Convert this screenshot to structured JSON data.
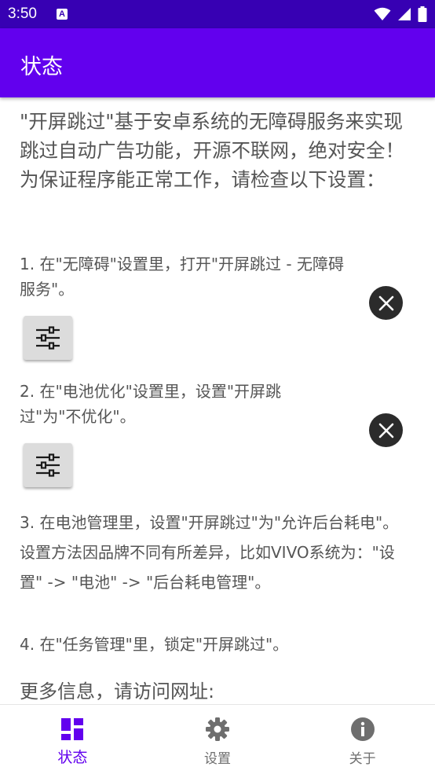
{
  "status_bar": {
    "time": "3:50",
    "notification_letter": "A"
  },
  "app_bar": {
    "title": "状态"
  },
  "intro": "\"开屏跳过\"基于安卓系统的无障碍服务来实现跳过自动广告功能，开源不联网，绝对安全！为保证程序能正常工作，请检查以下设置：",
  "steps": [
    {
      "text": "1. 在\"无障碍\"设置里，打开\"开屏跳过 - 无障碍服务\"。"
    },
    {
      "text": "2. 在\"电池优化\"设置里，设置\"开屏跳过\"为\"不优化\"。"
    },
    {
      "text": "3. 在电池管理里，设置\"开屏跳过\"为\"允许后台耗电\"。设置方法因品牌不同有所差异，比如VIVO系统为：\"设置\" -> \"电池\" -> \"后台耗电管理\"。"
    },
    {
      "text": "4. 在\"任务管理\"里，锁定\"开屏跳过\"。"
    }
  ],
  "more_info": "更多信息，请访问网址:",
  "bottom_nav": {
    "items": [
      {
        "label": "状态",
        "active": true
      },
      {
        "label": "设置",
        "active": false
      },
      {
        "label": "关于",
        "active": false
      }
    ]
  },
  "colors": {
    "primary": "#6200ee",
    "primary_dark": "#3700b3",
    "text": "#555555",
    "inactive": "#6e6e6e"
  }
}
